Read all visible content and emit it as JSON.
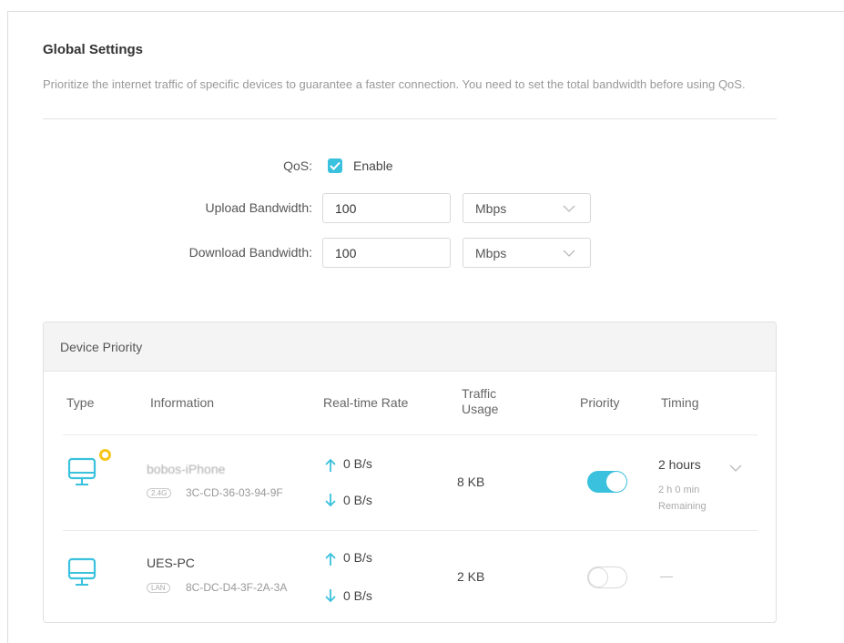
{
  "global": {
    "title": "Global Settings",
    "description": "Prioritize the internet traffic of specific devices to guarantee a faster connection. You need to set the total bandwidth before using QoS."
  },
  "qos": {
    "label": "QoS:",
    "enable_label": "Enable",
    "enabled": true
  },
  "upload": {
    "label": "Upload Bandwidth:",
    "value": "100",
    "unit": "Mbps"
  },
  "download": {
    "label": "Download Bandwidth:",
    "value": "100",
    "unit": "Mbps"
  },
  "device_priority": {
    "title": "Device Priority",
    "columns": {
      "type": "Type",
      "information": "Information",
      "rate": "Real-time Rate",
      "traffic": "Traffic Usage",
      "priority": "Priority",
      "timing": "Timing"
    },
    "devices": [
      {
        "name": "bobos-iPhone",
        "connection": "2.4G",
        "mac": "3C-CD-36-03-94-9F",
        "upload_rate": "0 B/s",
        "download_rate": "0 B/s",
        "traffic": "8 KB",
        "priority_on": true,
        "timing": "2 hours",
        "timing_remaining": "2 h 0 min",
        "timing_remaining_label": "Remaining"
      },
      {
        "name": "UES-PC",
        "connection": "LAN",
        "mac": "8C-DC-D4-3F-2A-3A",
        "upload_rate": "0 B/s",
        "download_rate": "0 B/s",
        "traffic": "2 KB",
        "priority_on": false,
        "timing": "—"
      }
    ]
  },
  "colors": {
    "accent": "#3ac1dd",
    "badge": "#f5c518"
  }
}
